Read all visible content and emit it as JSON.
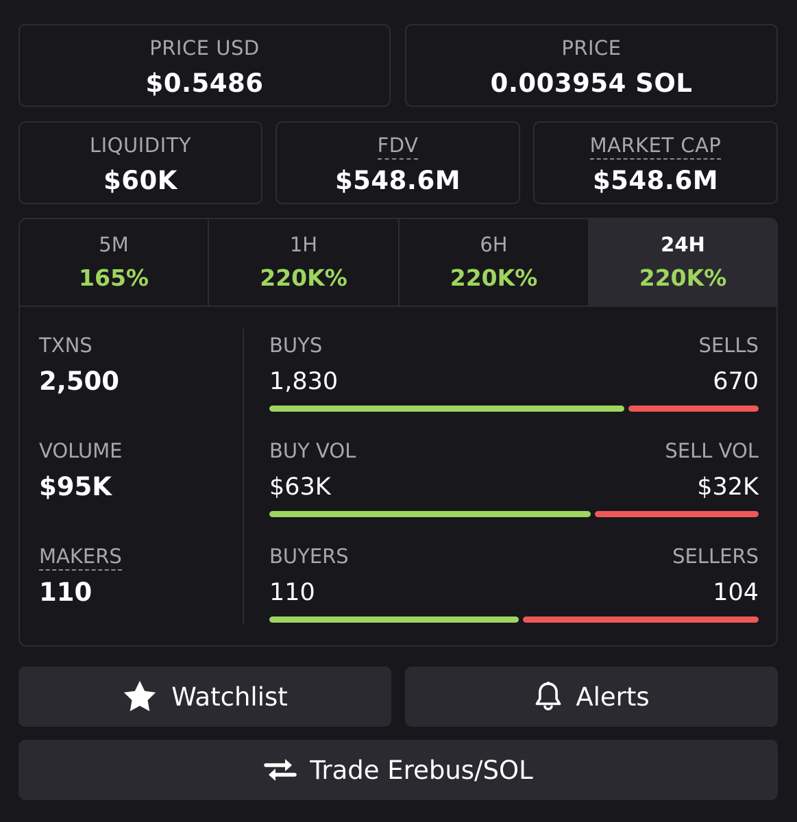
{
  "price_usd": {
    "label": "PRICE USD",
    "value": "$0.5486"
  },
  "price_sol": {
    "label": "PRICE",
    "value": "0.003954 SOL"
  },
  "liquidity": {
    "label": "LIQUIDITY",
    "value": "$60K"
  },
  "fdv": {
    "label": "FDV",
    "value": "$548.6M"
  },
  "market_cap": {
    "label": "MARKET CAP",
    "value": "$548.6M"
  },
  "tabs": [
    {
      "label": "5M",
      "value": "165%"
    },
    {
      "label": "1H",
      "value": "220K%"
    },
    {
      "label": "6H",
      "value": "220K%"
    },
    {
      "label": "24H",
      "value": "220K%",
      "active": true
    }
  ],
  "stats": {
    "txns": {
      "label": "TXNS",
      "value": "2,500"
    },
    "volume": {
      "label": "VOLUME",
      "value": "$95K"
    },
    "makers": {
      "label": "MAKERS",
      "value": "110"
    }
  },
  "ratios": {
    "buys_sells": {
      "left_label": "BUYS",
      "left_value": "1,830",
      "right_label": "SELLS",
      "right_value": "670",
      "buy_fraction": 0.732
    },
    "vol": {
      "left_label": "BUY VOL",
      "left_value": "$63K",
      "right_label": "SELL VOL",
      "right_value": "$32K",
      "buy_fraction": 0.663
    },
    "buyers_sellers": {
      "left_label": "BUYERS",
      "left_value": "110",
      "right_label": "SELLERS",
      "right_value": "104",
      "buy_fraction": 0.514
    }
  },
  "actions": {
    "watchlist": {
      "label": "Watchlist",
      "icon": "star-icon"
    },
    "alerts": {
      "label": "Alerts",
      "icon": "bell-icon"
    },
    "trade": {
      "label": "Trade Erebus/SOL",
      "icon": "swap-arrows-icon"
    }
  },
  "colors": {
    "positive": "#9ed55f",
    "negative": "#ef5757",
    "background": "#17171c",
    "button": "#2a2a30"
  }
}
